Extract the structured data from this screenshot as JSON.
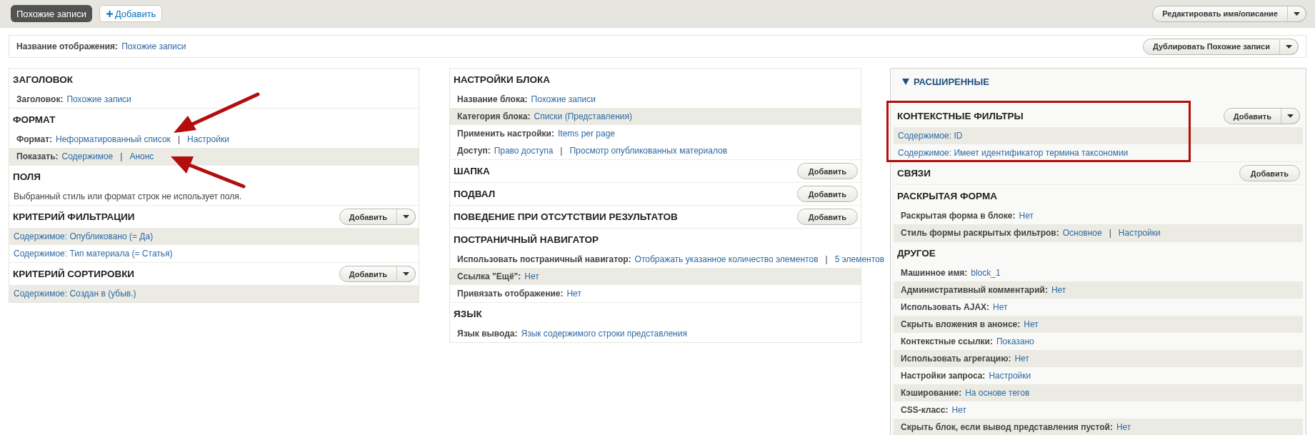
{
  "top_bar": {
    "display_tab": {
      "label": "Похожие записи",
      "selected": true
    },
    "add_button": {
      "label": "Добавить"
    },
    "edit_button": {
      "label": "Редактировать имя/описание"
    }
  },
  "display_name": {
    "label": "Название отображения:",
    "value": "Похожие записи",
    "duplicate_button": "Дублировать Похожие записи"
  },
  "columns": [
    {
      "sections": [
        {
          "title": "ЗАГОЛОВОК",
          "rows": [
            {
              "kind": "setting",
              "label": "Заголовок:",
              "shaded": false,
              "parts": [
                {
                  "kind": "link",
                  "text": "Похожие записи"
                }
              ]
            }
          ]
        },
        {
          "title": "ФОРМАТ",
          "rows": [
            {
              "kind": "setting",
              "label": "Формат:",
              "shaded": false,
              "arrow": {
                "kind": "upper"
              },
              "parts": [
                {
                  "kind": "link",
                  "text": "Неформатированный список"
                },
                {
                  "kind": "divider",
                  "text": "|"
                },
                {
                  "kind": "link",
                  "text": "Настройки"
                }
              ]
            },
            {
              "kind": "setting",
              "label": "Показать:",
              "shaded": true,
              "arrow": {
                "kind": "lower"
              },
              "parts": [
                {
                  "kind": "link",
                  "text": "Содержимое"
                },
                {
                  "kind": "divider",
                  "text": "|"
                },
                {
                  "kind": "link",
                  "text": "Анонс"
                }
              ]
            }
          ]
        },
        {
          "title": "ПОЛЯ",
          "rows": [
            {
              "kind": "note",
              "text": "Выбранный стиль или формат строк не использует поля.",
              "shaded": false
            }
          ]
        },
        {
          "title": "КРИТЕРИЙ ФИЛЬТРАЦИИ",
          "button": {
            "label": "Добавить",
            "split": true
          },
          "rows": [
            {
              "kind": "link",
              "text": "Содержимое: Опубликовано (= Да)",
              "shaded": true
            },
            {
              "kind": "link",
              "text": "Содержимое: Тип материала (= Статья)",
              "shaded": false
            }
          ]
        },
        {
          "title": "КРИТЕРИЙ СОРТИРОВКИ",
          "button": {
            "label": "Добавить",
            "split": true
          },
          "rows": [
            {
              "kind": "link",
              "text": "Содержимое: Создан в (убыв.)",
              "shaded": true
            }
          ]
        }
      ]
    },
    {
      "sections": [
        {
          "title": "НАСТРОЙКИ БЛОКА",
          "rows": [
            {
              "kind": "setting",
              "label": "Название блока:",
              "shaded": false,
              "parts": [
                {
                  "kind": "link",
                  "text": "Похожие записи"
                }
              ]
            },
            {
              "kind": "setting",
              "label": "Категория блока:",
              "shaded": true,
              "parts": [
                {
                  "kind": "link",
                  "text": "Списки (Представления)"
                }
              ]
            },
            {
              "kind": "setting",
              "label": "Применить настройки:",
              "shaded": false,
              "parts": [
                {
                  "kind": "link",
                  "text": "Items per page"
                }
              ]
            },
            {
              "kind": "setting",
              "label": "Доступ:",
              "shaded": false,
              "parts": [
                {
                  "kind": "link",
                  "text": "Право доступа"
                },
                {
                  "kind": "divider",
                  "text": "|"
                },
                {
                  "kind": "link",
                  "text": "Просмотр опубликованных материалов"
                }
              ]
            }
          ]
        },
        {
          "title": "ШАПКА",
          "button": {
            "label": "Добавить",
            "split": false
          }
        },
        {
          "title": "ПОДВАЛ",
          "button": {
            "label": "Добавить",
            "split": false
          }
        },
        {
          "title": "ПОВЕДЕНИЕ ПРИ ОТСУТСТВИИ РЕЗУЛЬТАТОВ",
          "button": {
            "label": "Добавить",
            "split": false
          }
        },
        {
          "title": "ПОСТРАНИЧНЫЙ НАВИГАТОР",
          "rows": [
            {
              "kind": "setting",
              "label": "Использовать постраничный навигатор:",
              "shaded": false,
              "parts": [
                {
                  "kind": "link",
                  "text": "Отображать указанное количество элементов"
                },
                {
                  "kind": "divider",
                  "text": "|"
                },
                {
                  "kind": "link",
                  "text": "5 элементов"
                }
              ]
            },
            {
              "kind": "setting",
              "label": "Ссылка \"Ещё\":",
              "shaded": true,
              "parts": [
                {
                  "kind": "link",
                  "text": "Нет"
                }
              ]
            },
            {
              "kind": "setting",
              "label": "Привязать отображение:",
              "shaded": false,
              "parts": [
                {
                  "kind": "link",
                  "text": "Нет"
                }
              ]
            }
          ]
        },
        {
          "title": "ЯЗЫК",
          "rows": [
            {
              "kind": "setting",
              "label": "Язык вывода:",
              "shaded": false,
              "parts": [
                {
                  "kind": "link",
                  "text": "Язык содержимого строки представления"
                }
              ]
            }
          ]
        }
      ]
    },
    {
      "collapsible": {
        "label": "РАСШИРЕННЫЕ",
        "expanded": true
      },
      "sections": [
        {
          "title": "КОНТЕКСТНЫЕ ФИЛЬТРЫ",
          "button": {
            "label": "Добавить",
            "split": true
          },
          "highlighted": true,
          "rows": [
            {
              "kind": "link",
              "text": "Содержимое: ID",
              "shaded": true
            },
            {
              "kind": "link",
              "text": "Содержимое: Имеет идентификатор термина таксономии",
              "shaded": false
            }
          ]
        },
        {
          "title": "СВЯЗИ",
          "button": {
            "label": "Добавить",
            "split": false
          }
        },
        {
          "title": "РАСКРЫТАЯ ФОРМА",
          "rows": [
            {
              "kind": "setting",
              "label": "Раскрытая форма в блоке:",
              "shaded": false,
              "parts": [
                {
                  "kind": "link",
                  "text": "Нет"
                }
              ]
            },
            {
              "kind": "setting",
              "label": "Стиль формы раскрытых фильтров:",
              "shaded": true,
              "parts": [
                {
                  "kind": "link",
                  "text": "Основное"
                },
                {
                  "kind": "divider",
                  "text": "|"
                },
                {
                  "kind": "link",
                  "text": "Настройки"
                }
              ]
            }
          ]
        },
        {
          "title": "ДРУГОЕ",
          "rows": [
            {
              "kind": "setting",
              "label": "Машинное имя:",
              "shaded": false,
              "parts": [
                {
                  "kind": "link",
                  "text": "block_1"
                }
              ]
            },
            {
              "kind": "setting",
              "label": "Административный комментарий:",
              "shaded": true,
              "parts": [
                {
                  "kind": "link",
                  "text": "Нет"
                }
              ]
            },
            {
              "kind": "setting",
              "label": "Использовать AJAX:",
              "shaded": false,
              "parts": [
                {
                  "kind": "link",
                  "text": "Нет"
                }
              ]
            },
            {
              "kind": "setting",
              "label": "Скрыть вложения в анонсе:",
              "shaded": true,
              "parts": [
                {
                  "kind": "link",
                  "text": "Нет"
                }
              ]
            },
            {
              "kind": "setting",
              "label": "Контекстные ссылки:",
              "shaded": false,
              "parts": [
                {
                  "kind": "link",
                  "text": "Показано"
                }
              ]
            },
            {
              "kind": "setting",
              "label": "Использовать агрегацию:",
              "shaded": true,
              "parts": [
                {
                  "kind": "link",
                  "text": "Нет"
                }
              ]
            },
            {
              "kind": "setting",
              "label": "Настройки запроса:",
              "shaded": false,
              "parts": [
                {
                  "kind": "link",
                  "text": "Настройки"
                }
              ]
            },
            {
              "kind": "setting",
              "label": "Кэширование:",
              "shaded": true,
              "parts": [
                {
                  "kind": "link",
                  "text": "На основе тегов"
                }
              ]
            },
            {
              "kind": "setting",
              "label": "CSS-класс:",
              "shaded": false,
              "parts": [
                {
                  "kind": "link",
                  "text": "Нет"
                }
              ]
            },
            {
              "kind": "setting",
              "label": "Скрыть блок, если вывод представления пустой:",
              "shaded": true,
              "parts": [
                {
                  "kind": "link",
                  "text": "Нет"
                }
              ]
            }
          ]
        }
      ]
    }
  ]
}
